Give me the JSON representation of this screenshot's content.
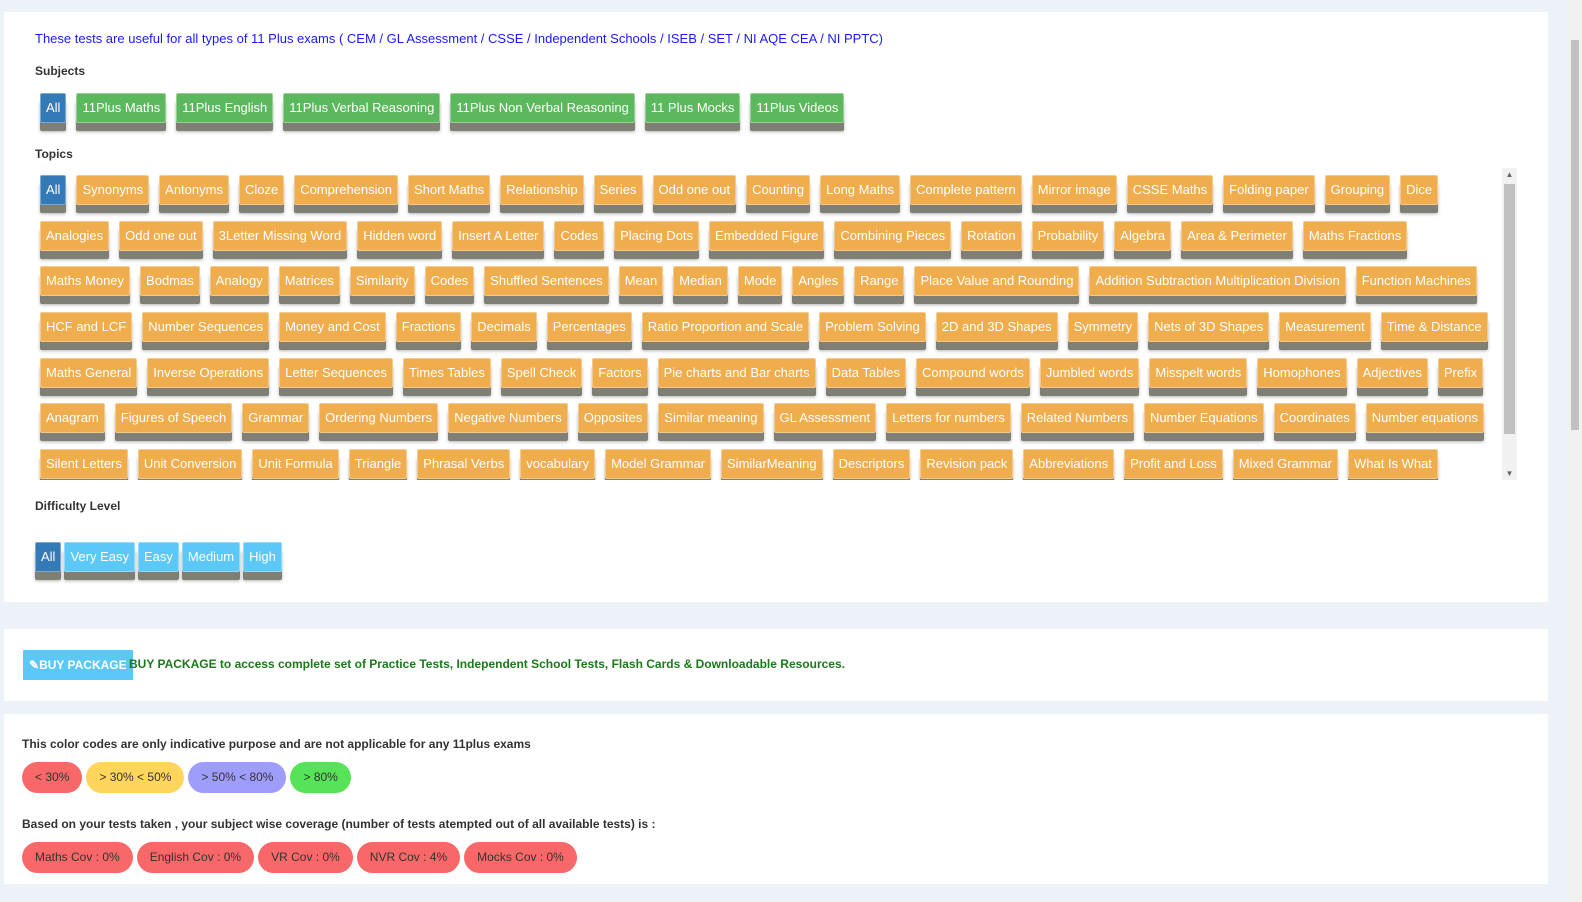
{
  "intro": "These tests are useful for all types of 11 Plus exams ( CEM / GL Assessment / CSSE / Independent Schools / ISEB / SET / NI AQE CEA / NI PPTC)",
  "subjects": {
    "label": "Subjects",
    "items": [
      "All",
      "11Plus Maths",
      "11Plus English",
      "11Plus Verbal Reasoning",
      "11Plus Non Verbal Reasoning",
      "11 Plus Mocks",
      "11Plus Videos"
    ],
    "selected": "All"
  },
  "topics": {
    "label": "Topics",
    "selected": "All",
    "items": [
      "All",
      "Synonyms",
      "Antonyms",
      "Cloze",
      "Comprehension",
      "Short Maths",
      "Relationship",
      "Series",
      "Odd one out",
      "Counting",
      "Long Maths",
      "Complete pattern",
      "Mirror image",
      "CSSE Maths",
      "Folding paper",
      "Grouping",
      "Dice",
      "Analogies",
      "Odd one out",
      "3Letter Missing Word",
      "Hidden word",
      "Insert A Letter",
      "Codes",
      "Placing Dots",
      "Embedded Figure",
      "Combining Pieces",
      "Rotation",
      "Probability",
      "Algebra",
      "Area & Perimeter",
      "Maths Fractions",
      "Maths Money",
      "Bodmas",
      "Analogy",
      "Matrices",
      "Similarity",
      "Codes",
      "Shuffled Sentences",
      "Mean",
      "Median",
      "Mode",
      "Angles",
      "Range",
      "Place Value and Rounding",
      "Addition Subtraction Multiplication Division",
      "Function Machines",
      "HCF and LCF",
      "Number Sequences",
      "Money and Cost",
      "Fractions",
      "Decimals",
      "Percentages",
      "Ratio Proportion and Scale",
      "Problem Solving",
      "2D and 3D Shapes",
      "Symmetry",
      "Nets of 3D Shapes",
      "Measurement",
      "Time & Distance",
      "Maths General",
      "Inverse Operations",
      "Letter Sequences",
      "Times Tables",
      "Spell Check",
      "Factors",
      "Pie charts and Bar charts",
      "Data Tables",
      "Compound words",
      "Jumbled words",
      "Misspelt words",
      "Homophones",
      "Adjectives",
      "Prefix",
      "Anagram",
      "Figures of Speech",
      "Grammar",
      "Ordering Numbers",
      "Negative Numbers",
      "Opposites",
      "Similar meaning",
      "GL Assessment",
      "Letters for numbers",
      "Related Numbers",
      "Number Equations",
      "Coordinates",
      "Number equations",
      "Silent Letters",
      "Unit Conversion",
      "Unit Formula",
      "Triangle",
      "Phrasal Verbs",
      "vocabulary",
      "Model Grammar",
      "SimilarMeaning",
      "Descriptors",
      "Revision pack",
      "Abbreviations",
      "Profit and Loss",
      "Mixed Grammar",
      "What Is What"
    ]
  },
  "difficulty": {
    "label": "Difficulty Level",
    "items": [
      "All",
      "Very Easy",
      "Easy",
      "Medium",
      "High"
    ],
    "selected": "All"
  },
  "buy": {
    "button": "BUY PACKAGE",
    "text": "BUY PACKAGE to access complete set of Practice Tests, Independent School Tests, Flash Cards & Downloadable Resources."
  },
  "legend": {
    "text": "This color codes are only indicative purpose and are not applicable for any 11plus exams",
    "items": [
      {
        "label": "< 30%",
        "color": "#f96868"
      },
      {
        "label": "> 30% < 50%",
        "color": "#ffd55b"
      },
      {
        "label": "> 50% < 80%",
        "color": "#9e9dfc"
      },
      {
        "label": "> 80%",
        "color": "#57e357"
      }
    ]
  },
  "coverage": {
    "text": "Based on your tests taken , your subject wise coverage (number of tests atempted out of all available tests) is :",
    "items": [
      "Maths Cov : 0%",
      "English Cov : 0%",
      "VR Cov : 0%",
      "NVR Cov : 4%",
      "Mocks Cov : 0%"
    ],
    "color": "#f96868"
  }
}
